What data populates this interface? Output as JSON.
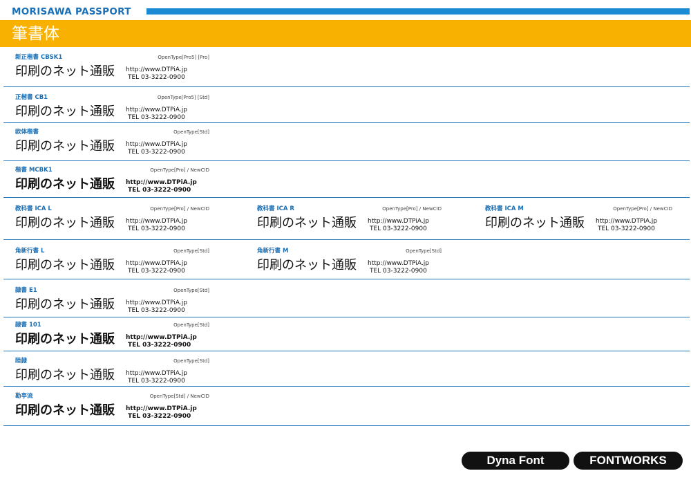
{
  "brand": "MORISAWA PASSPORT",
  "title": "筆書体",
  "sample_text": "印刷のネット通販",
  "url": "http://www.DTPiA.jp",
  "tel": "TEL 03-3222-0900",
  "rows": [
    {
      "cells": [
        {
          "name": "新正楷書 CBSK1",
          "format": "OpenType[Pro5] [Pro]"
        }
      ]
    },
    {
      "cells": [
        {
          "name": "正楷書 CB1",
          "format": "OpenType[Pro5] [Std]"
        }
      ]
    },
    {
      "cells": [
        {
          "name": "欧体楷書",
          "format": "OpenType[Std]"
        }
      ]
    },
    {
      "cells": [
        {
          "name": "楷書 MCBK1",
          "format": "OpenType[Pro] / NewCID"
        }
      ]
    },
    {
      "cells": [
        {
          "name": "教科書 ICA L",
          "format": "OpenType[Pro] / NewCID"
        },
        {
          "name": "教科書 ICA R",
          "format": "OpenType[Pro] / NewCID"
        },
        {
          "name": "教科書 ICA M",
          "format": "OpenType[Pro] / NewCID"
        }
      ]
    },
    {
      "cells": [
        {
          "name": "角新行書 L",
          "format": "OpenType[Std]"
        },
        {
          "name": "角新行書 M",
          "format": "OpenType[Std]"
        }
      ]
    },
    {
      "cells": [
        {
          "name": "隷書 E1",
          "format": "OpenType[Std]"
        }
      ]
    },
    {
      "cells": [
        {
          "name": "隷書 101",
          "format": "OpenType[Std]"
        }
      ]
    },
    {
      "cells": [
        {
          "name": "陸隷",
          "format": "OpenType[Std]"
        }
      ]
    },
    {
      "cells": [
        {
          "name": "勘亭流",
          "format": "OpenType[Std] / NewCID"
        }
      ]
    }
  ],
  "footer": {
    "dyna": "Dyna Font",
    "fontworks": "FONTWORKS"
  }
}
